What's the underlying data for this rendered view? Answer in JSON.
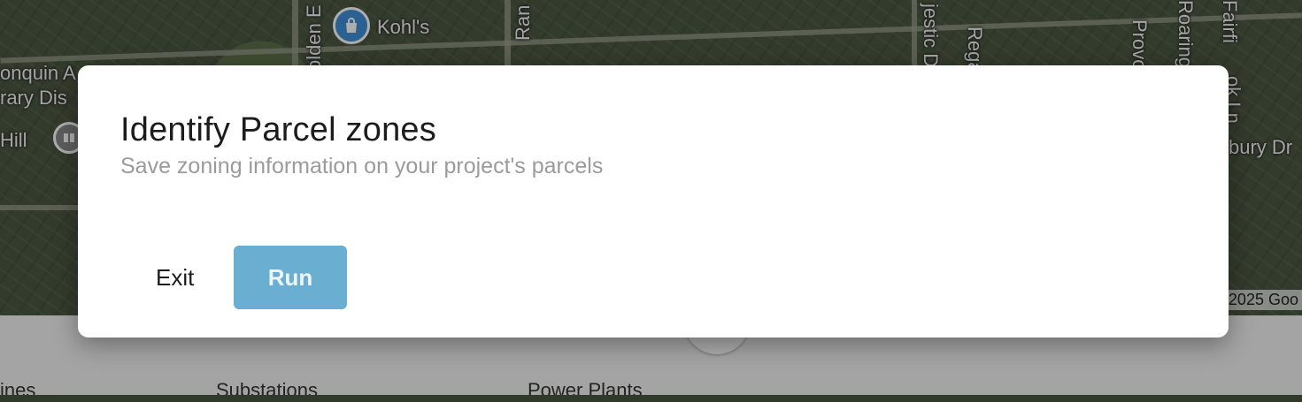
{
  "map": {
    "labels": {
      "kohls": "Kohl's",
      "algonquin": "onquin A",
      "library": "rary Dis",
      "hill": "Hill",
      "golden": "olden E",
      "ran": "Ran",
      "majestic": "jestic D",
      "rega": "Rega",
      "provo": "Provo",
      "roaring": "Roaring B",
      "fairfi": "Fairfi",
      "brook_ln": "ok Ln",
      "bury_dr": "bury Dr"
    },
    "attribution": "2025 Goo"
  },
  "bottom_bar": {
    "tabs": [
      "ines",
      "Substations",
      "Power Plants"
    ]
  },
  "modal": {
    "title": "Identify Parcel zones",
    "subtitle": "Save zoning information on your project's parcels",
    "exit_label": "Exit",
    "run_label": "Run"
  },
  "colors": {
    "run_button": "#6aaed2",
    "pin_blue": "#3f8fd6",
    "subtitle": "#9b9b9b"
  }
}
